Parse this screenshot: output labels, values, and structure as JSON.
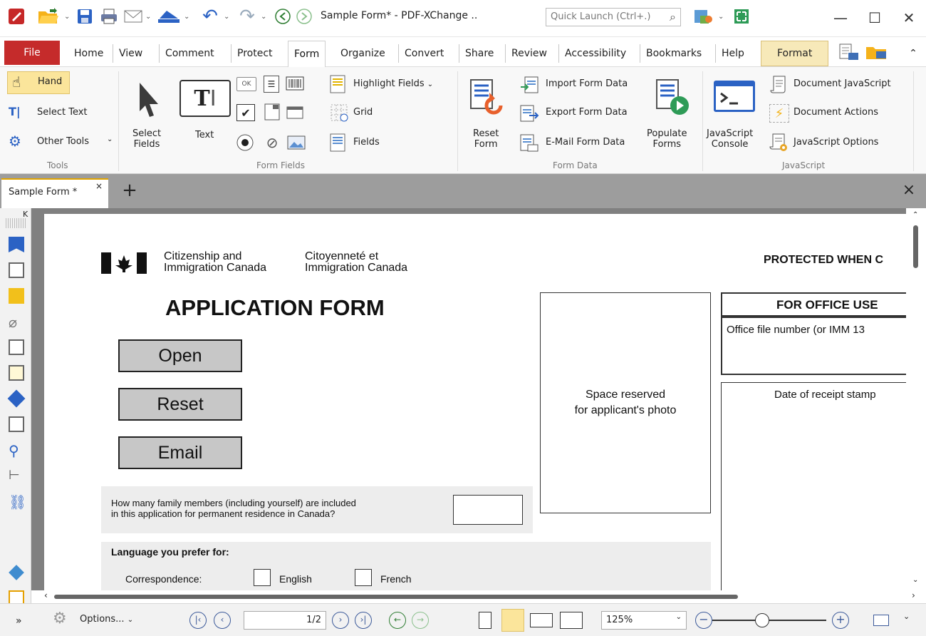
{
  "titlebar": {
    "title": "Sample Form* - PDF-XChange ..",
    "quick_launch_placeholder": "Quick Launch (Ctrl+.)"
  },
  "menu": {
    "file": "File",
    "tabs": [
      "Home",
      "View",
      "Comment",
      "Protect",
      "Form",
      "Organize",
      "Convert",
      "Share",
      "Review",
      "Accessibility",
      "Bookmarks",
      "Help"
    ],
    "format": "Format"
  },
  "ribbon": {
    "tools": {
      "hand": "Hand",
      "select_text": "Select Text",
      "other_tools": "Other Tools",
      "group": "Tools"
    },
    "form_fields": {
      "select_fields_1": "Select",
      "select_fields_2": "Fields",
      "text": "Text",
      "ok": "OK",
      "highlight_fields": "Highlight Fields",
      "grid": "Grid",
      "fields": "Fields",
      "group": "Form Fields"
    },
    "form_data": {
      "reset_1": "Reset",
      "reset_2": "Form",
      "import": "Import Form Data",
      "export": "Export Form Data",
      "email": "E-Mail Form Data",
      "populate_1": "Populate",
      "populate_2": "Forms",
      "group": "Form Data"
    },
    "javascript": {
      "console_1": "JavaScript",
      "console_2": "Console",
      "doc_js": "Document JavaScript",
      "doc_actions": "Document Actions",
      "js_options": "JavaScript Options",
      "group": "JavaScript"
    }
  },
  "doc_tab": {
    "label": "Sample Form *",
    "close": "×",
    "new": "+",
    "close_all": "×"
  },
  "page": {
    "dept_en_1": "Citizenship and",
    "dept_en_2": "Immigration Canada",
    "dept_fr_1": "Citoyenneté et",
    "dept_fr_2": "Immigration Canada",
    "protected": "PROTECTED WHEN C",
    "title": "APPLICATION FORM",
    "btn_open": "Open",
    "btn_reset": "Reset",
    "btn_email": "Email",
    "photo_1": "Space reserved",
    "photo_2": "for applicant's photo",
    "office_use": "FOR OFFICE USE",
    "office_file": "Office file number (or IMM 13",
    "receipt": "Date of receipt stamp",
    "family_q_1": "How many family members (including yourself) are included",
    "family_q_2": "in this application for permanent residence in Canada?",
    "language": "Language you prefer for:",
    "correspondence": "Correspondence:",
    "english": "English",
    "french": "French"
  },
  "status": {
    "options": "Options...",
    "page_input": "1",
    "page_total": "/2",
    "zoom": "125%"
  }
}
